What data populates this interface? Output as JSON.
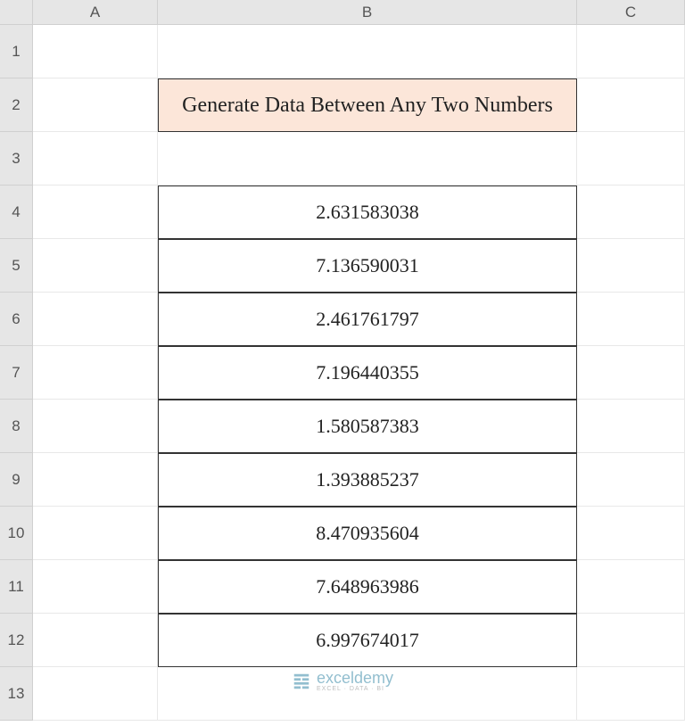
{
  "columns": [
    "A",
    "B",
    "C"
  ],
  "rows": [
    "1",
    "2",
    "3",
    "4",
    "5",
    "6",
    "7",
    "8",
    "9",
    "10",
    "11",
    "12",
    "13"
  ],
  "title": "Generate Data Between Any Two Numbers",
  "titleCell": "B2",
  "data": {
    "B4": "2.631583038",
    "B5": "7.136590031",
    "B6": "2.461761797",
    "B7": "7.196440355",
    "B8": "1.580587383",
    "B9": "1.393885237",
    "B10": "8.470935604",
    "B11": "7.648963986",
    "B12": "6.997674017"
  },
  "watermark": {
    "main": "exceldemy",
    "sub": "EXCEL · DATA · BI"
  }
}
